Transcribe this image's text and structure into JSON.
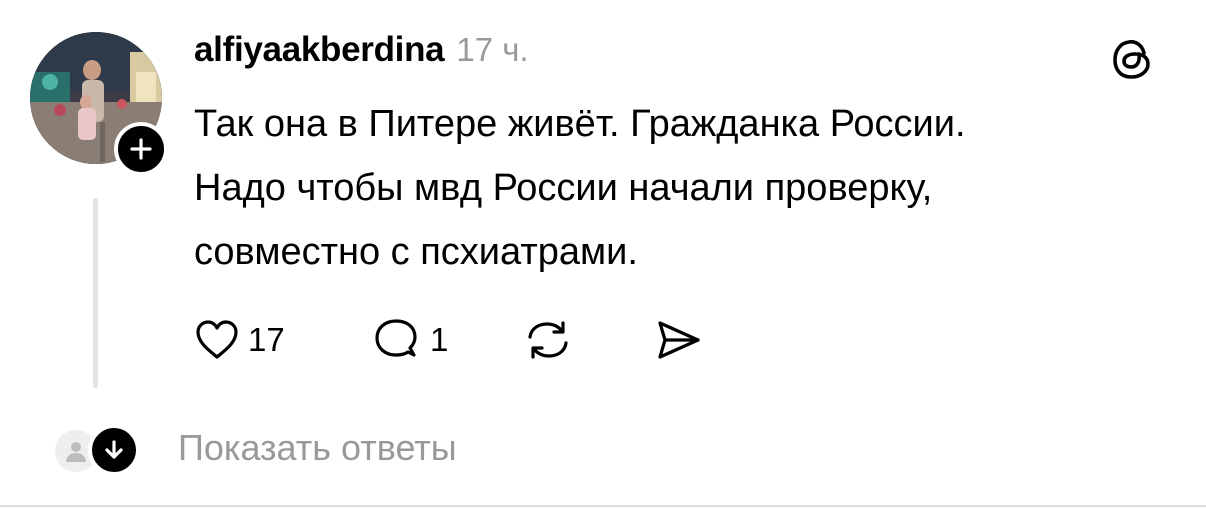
{
  "post": {
    "username": "alfiyaakberdina",
    "time": "17 ч.",
    "text_lines": [
      "Так она в Питере живёт. Гражданка России.",
      "Надо чтобы мвд России начали проверку,",
      "совместно с псхиатрами."
    ]
  },
  "actions": {
    "likes": "17",
    "replies": "1",
    "like_icon": "heart-icon",
    "reply_icon": "speech-bubble-icon",
    "repost_icon": "repost-icon",
    "share_icon": "send-icon"
  },
  "replies_link": {
    "label": "Показать ответы"
  },
  "icons": {
    "follow": "plus-icon",
    "app": "threads-logo-icon",
    "expand": "arrow-down-icon"
  },
  "colors": {
    "text": "#000000",
    "muted": "#999999",
    "thread_line": "#e3e3e3"
  }
}
